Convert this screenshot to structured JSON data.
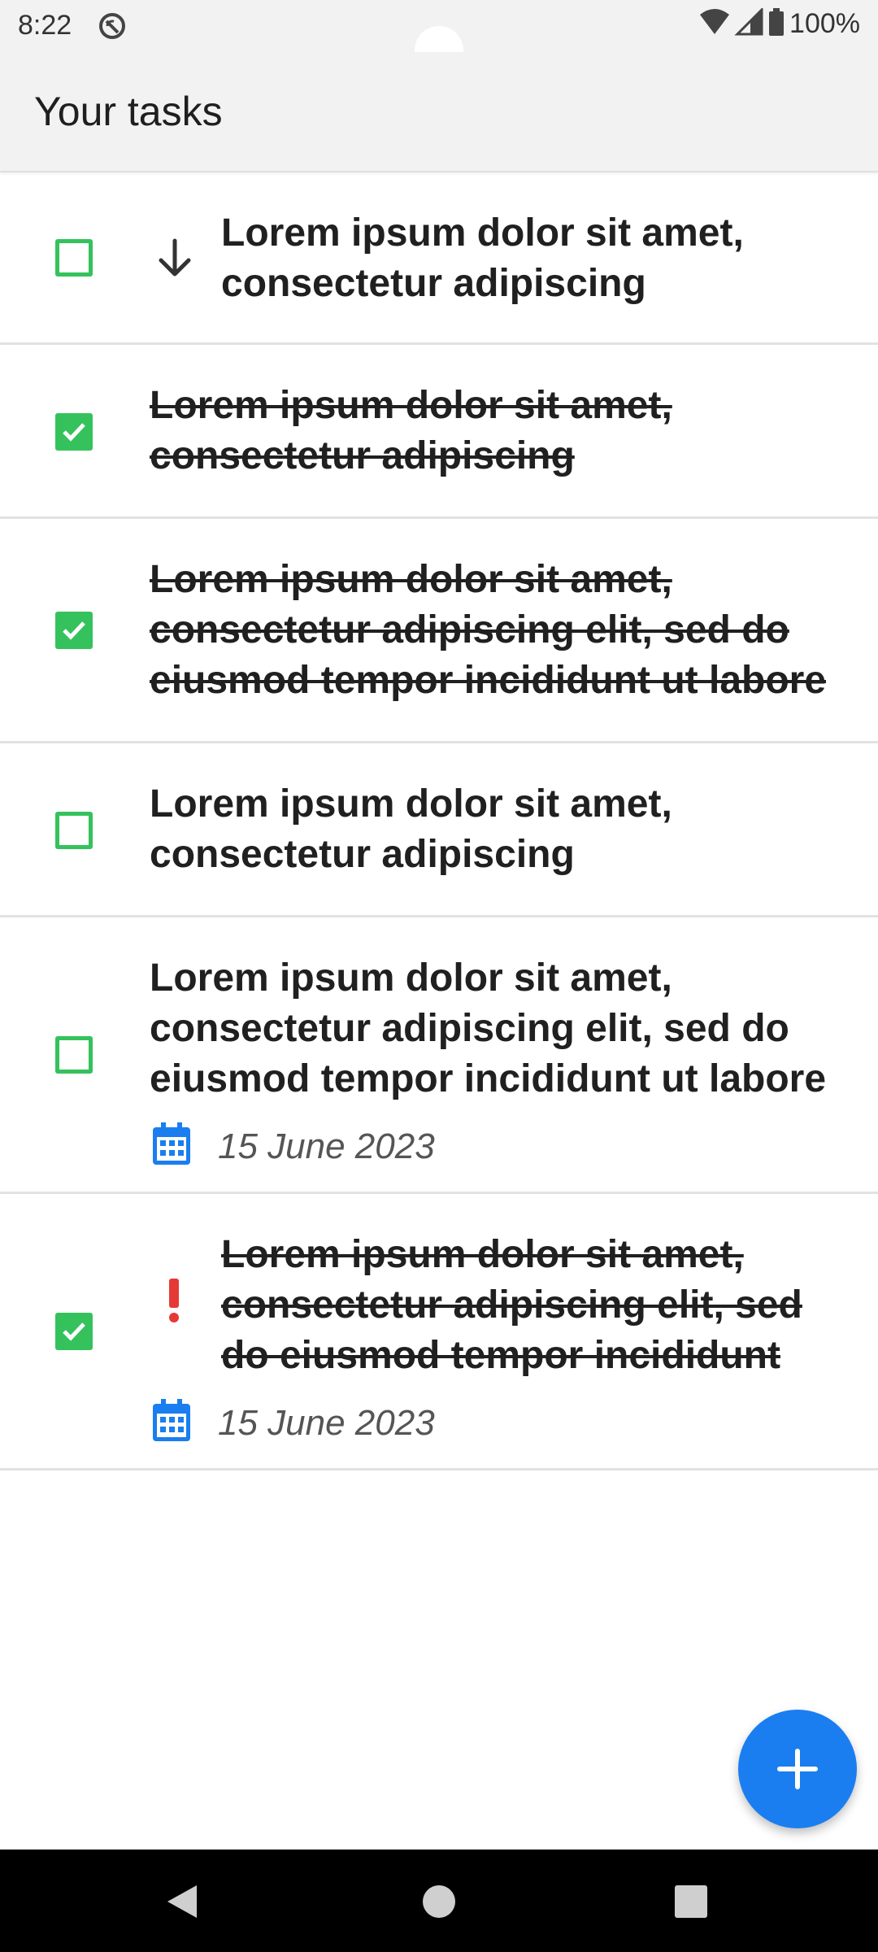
{
  "status_bar": {
    "time": "8:22",
    "battery": "100%",
    "icons": [
      "sync-disabled-icon",
      "wifi-icon",
      "signal-icon",
      "battery-icon"
    ]
  },
  "app_bar": {
    "title": "Your tasks"
  },
  "tasks": [
    {
      "text": "Lorem ipsum dolor sit amet, consectetur adipiscing",
      "checked": false,
      "lead_icon": "arrow-down-icon"
    },
    {
      "text": "Lorem ipsum dolor sit amet, consectetur adipiscing",
      "checked": true
    },
    {
      "text": "Lorem ipsum dolor sit amet, consectetur adipiscing elit, sed do eiusmod tempor incididunt ut labore",
      "checked": true
    },
    {
      "text": "Lorem ipsum dolor sit amet, consectetur adipiscing",
      "checked": false
    },
    {
      "text": "Lorem ipsum dolor sit amet, consectetur adipiscing elit, sed do eiusmod tempor incididunt ut labore",
      "checked": false,
      "due": "15 June 2023"
    },
    {
      "text": "Lorem ipsum dolor sit amet, consectetur adipiscing elit, sed do eiusmod tempor incididunt",
      "checked": true,
      "lead_icon": "priority-high-icon",
      "due": "15 June 2023"
    }
  ],
  "fab": {
    "icon": "plus-icon"
  },
  "colors": {
    "checkbox": "#35c25c",
    "fab": "#1a7ef0",
    "calendar": "#1a7ef0",
    "priority": "#e53935"
  }
}
